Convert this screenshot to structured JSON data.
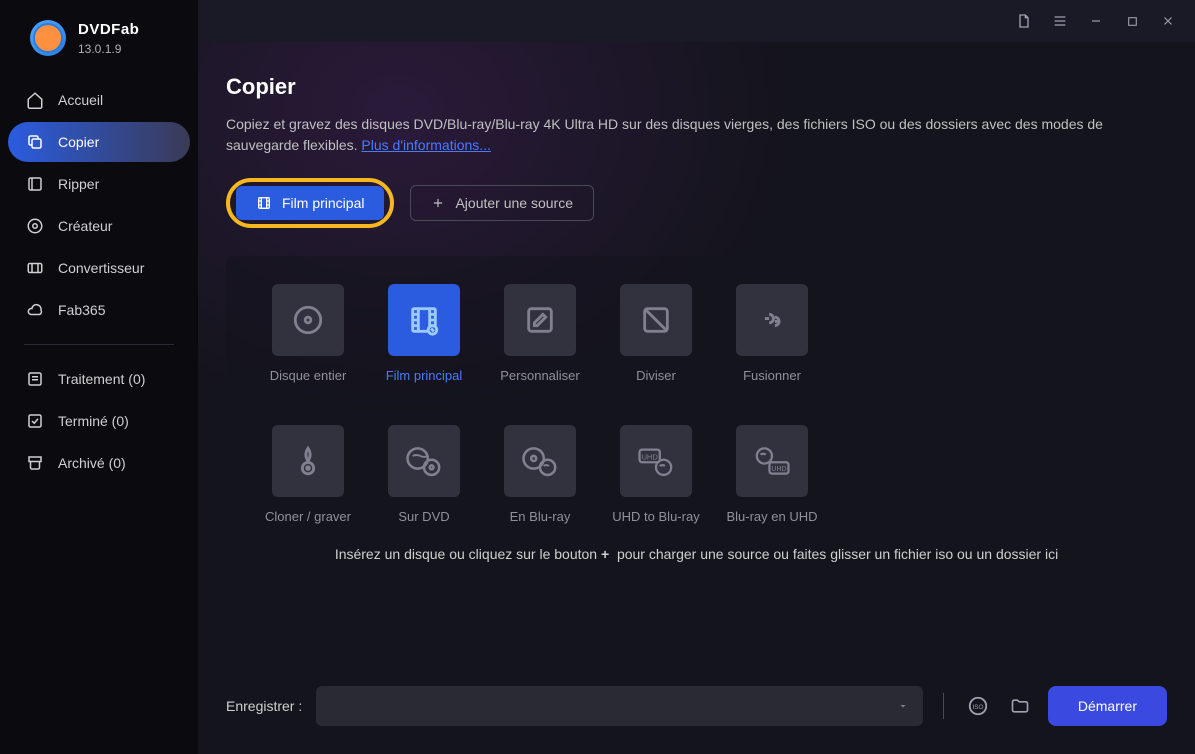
{
  "brand": {
    "name": "DVDFab",
    "version": "13.0.1.9"
  },
  "nav": {
    "items": [
      {
        "label": "Accueil",
        "icon": "home"
      },
      {
        "label": "Copier",
        "icon": "copy",
        "active": true
      },
      {
        "label": "Ripper",
        "icon": "ripper"
      },
      {
        "label": "Créateur",
        "icon": "creator"
      },
      {
        "label": "Convertisseur",
        "icon": "converter"
      },
      {
        "label": "Fab365",
        "icon": "cloud"
      }
    ],
    "secondary": [
      {
        "label": "Traitement (0)"
      },
      {
        "label": "Terminé (0)"
      },
      {
        "label": "Archivé (0)"
      }
    ]
  },
  "page": {
    "title": "Copier",
    "description": "Copiez et gravez des disques DVD/Blu-ray/Blu-ray 4K Ultra HD sur des disques vierges, des fichiers ISO ou des dossiers avec des modes de sauvegarde flexibles.",
    "more_link": "Plus d'informations..."
  },
  "actions": {
    "main_mode": "Film principal",
    "add_source": "Ajouter une source"
  },
  "modes": [
    {
      "label": "Disque entier"
    },
    {
      "label": "Film principal",
      "active": true
    },
    {
      "label": "Personnaliser"
    },
    {
      "label": "Diviser"
    },
    {
      "label": "Fusionner"
    },
    {
      "label": "Cloner / graver"
    },
    {
      "label": "Sur DVD"
    },
    {
      "label": "En Blu-ray"
    },
    {
      "label": "UHD to Blu-ray"
    },
    {
      "label": "Blu-ray en UHD"
    }
  ],
  "dropzone": {
    "text_before": "Insérez un disque ou cliquez sur le bouton",
    "plus": "+",
    "text_after": "pour charger une source ou faites glisser un fichier iso ou un dossier ici"
  },
  "footer": {
    "save_label": "Enregistrer :",
    "start": "Démarrer"
  }
}
